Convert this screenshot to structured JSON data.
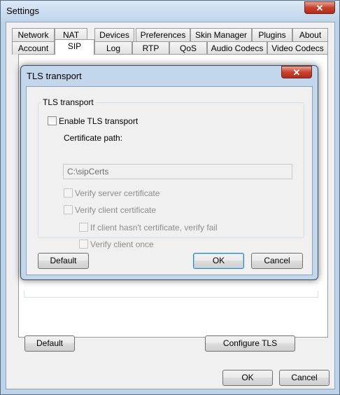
{
  "settings": {
    "title": "Settings",
    "close_glyph": "✕",
    "tabs_row1": [
      "Network",
      "NAT",
      "Devices",
      "Preferences",
      "Skin Manager",
      "Plugins",
      "About"
    ],
    "tabs_row2": [
      "Account",
      "SIP",
      "Log",
      "RTP",
      "QoS",
      "Audio Codecs",
      "Video Codecs"
    ],
    "active_tab": "SIP",
    "default_label": "Default",
    "configure_tls_label": "Configure TLS",
    "ok_label": "OK",
    "cancel_label": "Cancel"
  },
  "tls_dialog": {
    "title": "TLS transport",
    "close_glyph": "✕",
    "group_label": "TLS transport",
    "enable_tls_label": "Enable TLS transport",
    "enable_tls_checked": false,
    "cert_path_label": "Certificate path:",
    "cert_path_value": "C:\\sipCerts",
    "verify_server_label": "Verify server certificate",
    "verify_client_label": "Verify client certificate",
    "verify_fail_label": "If client hasn't certificate, verify fail",
    "verify_once_label": "Verify client once",
    "default_label": "Default",
    "ok_label": "OK",
    "cancel_label": "Cancel"
  }
}
